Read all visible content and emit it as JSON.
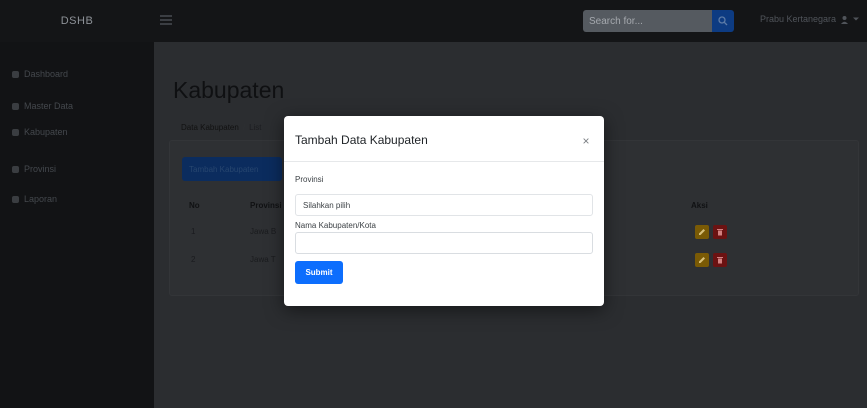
{
  "brand": "DSHB",
  "topbar": {
    "search_placeholder": "Search for...",
    "user_name": "Prabu Kertanegara"
  },
  "sidebar": {
    "items": [
      {
        "label": "Dashboard"
      },
      {
        "label": "Master Data"
      },
      {
        "label": "Kabupaten"
      },
      {
        "label": "Provinsi"
      },
      {
        "label": "Laporan"
      }
    ]
  },
  "main": {
    "title": "Kabupaten",
    "breadcrumb": {
      "parent": "Data Kabupaten",
      "current": "List"
    },
    "add_button": "Tambah Kabupaten",
    "table": {
      "headers": [
        "No",
        "Provinsi",
        "Aksi"
      ],
      "rows": [
        {
          "no": "1",
          "provinsi": "Jawa B"
        },
        {
          "no": "2",
          "provinsi": "Jawa T"
        }
      ]
    }
  },
  "modal": {
    "title": "Tambah Data Kabupaten",
    "close_glyph": "×",
    "provinsi_label": "Provinsi",
    "provinsi_value": "Silahkan pilih",
    "kabupaten_label": "Nama Kabupaten/Kota",
    "kabupaten_value": "",
    "submit_label": "Submit"
  },
  "colors": {
    "primary": "#0d6efd",
    "edit": "#7a5a05",
    "delete": "#6b1212"
  }
}
